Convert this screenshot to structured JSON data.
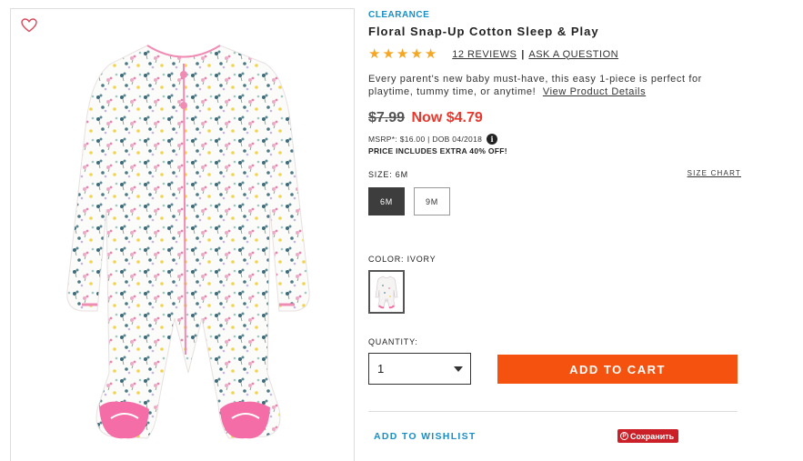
{
  "product": {
    "badge": "CLEARANCE",
    "title": "Floral Snap-Up Cotton Sleep & Play",
    "rating_stars": 5,
    "reviews_link": "12 REVIEWS",
    "ask_link": "ASK A QUESTION",
    "description": "Every parent's new baby must-have, this easy 1-piece is perfect for playtime, tummy time, or anytime!",
    "view_details_link": "View Product Details",
    "old_price": "$7.99",
    "now_price": "Now $4.79",
    "msrp_line": "MSRP*: $16.00 | DOB 04/2018",
    "extra_discount": "PRICE INCLUDES EXTRA 40% OFF!"
  },
  "size": {
    "label": "SIZE: 6M",
    "chart_link": "SIZE CHART",
    "options": [
      "6M",
      "9M"
    ],
    "selected": "6M"
  },
  "color": {
    "label": "COLOR: IVORY"
  },
  "quantity": {
    "label": "QUANTITY:",
    "value": "1"
  },
  "actions": {
    "add_to_cart": "ADD TO CART",
    "wishlist": "ADD TO WISHLIST",
    "pin": "Сохранить"
  },
  "colors": {
    "accent_blue": "#1a8fc6",
    "sale_red": "#e8382e",
    "cta_orange": "#f4520e",
    "star": "#f5a623",
    "pinterest": "#cb2027"
  }
}
